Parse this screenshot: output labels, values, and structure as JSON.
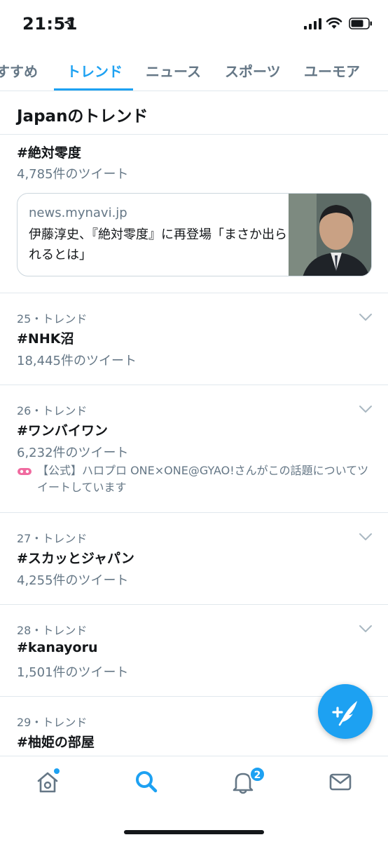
{
  "status_bar": {
    "time": "21:51",
    "icons": [
      "location-arrow-icon",
      "cellular-signal-icon",
      "wifi-icon",
      "battery-icon"
    ]
  },
  "tabs": [
    {
      "label": "すすめ",
      "active": false
    },
    {
      "label": "トレンド",
      "active": true
    },
    {
      "label": "ニュース",
      "active": false
    },
    {
      "label": "スポーツ",
      "active": false
    },
    {
      "label": "ユーモア",
      "active": false
    }
  ],
  "section": {
    "title": "Japanのトレンド"
  },
  "top_trend": {
    "name": "#絶対零度",
    "count": "4,785件のツイート",
    "news_card": {
      "source": "news.mynavi.jp",
      "headline": "伊藤淳史、『絶対零度』に再登場「まさか出られるとは」"
    }
  },
  "trends": [
    {
      "meta": "25・トレンド",
      "name": "#NHK沼",
      "count": "18,445件のツイート"
    },
    {
      "meta": "26・トレンド",
      "name": "#ワンバイワン",
      "count": "6,232件のツイート",
      "promo": "【公式】ハロプロ ONE×ONE@GYAO!さんがこの話題についてツイートしています"
    },
    {
      "meta": "27・トレンド",
      "name": "#スカッとジャパン",
      "count": "4,255件のツイート"
    },
    {
      "meta": "28・トレンド",
      "name": "#kanayoru",
      "count": "1,501件のツイート"
    },
    {
      "meta": "29・トレンド",
      "name": "#柚姫の部屋"
    }
  ],
  "bottom_nav": {
    "items": [
      "home-icon",
      "search-icon",
      "notifications-icon",
      "messages-icon"
    ],
    "notification_badge": "2"
  },
  "colors": {
    "accent": "#1da1f2",
    "text": "#14171a",
    "muted": "#657786",
    "border": "#e1e8ed"
  }
}
